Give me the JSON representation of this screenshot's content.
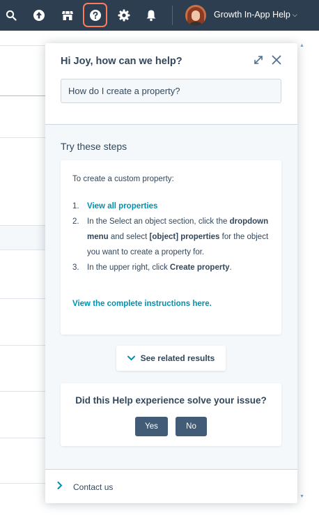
{
  "topnav": {
    "icons": [
      "search-icon",
      "upgrade-arrow-icon",
      "marketplace-icon",
      "help-icon",
      "settings-gear-icon",
      "notifications-bell-icon"
    ],
    "account_name": "Growth In-App Help",
    "account_chevron": "⌵"
  },
  "help_panel": {
    "greeting": "Hi Joy, how can we help?",
    "search": {
      "value": "How do I create a property?"
    },
    "steps_heading": "Try these steps",
    "intro": "To create a custom property:",
    "steps": [
      {
        "num": "1.",
        "link": "View all properties"
      },
      {
        "num": "2.",
        "text_a": "In the Select an object section, click the ",
        "bold_a": "dropdown menu",
        "text_b": " and select ",
        "bold_b": "[object] properties",
        "text_c": " for the object you want to create a property for."
      },
      {
        "num": "3.",
        "text_a": "In the upper right, click ",
        "bold_a": "Create property",
        "text_b": "."
      }
    ],
    "complete_link": "View the complete instructions here.",
    "related_label": "See related results",
    "solve_question": "Did this Help experience solve your issue?",
    "yes_label": "Yes",
    "no_label": "No",
    "contact_label": "Contact us"
  },
  "colors": {
    "nav_bg": "#2d3e50",
    "accent_orange": "#ff7a59",
    "link_teal": "#0091ae",
    "button_slate": "#425b76",
    "panel_bg": "#f5f8fa",
    "text": "#33475b"
  }
}
